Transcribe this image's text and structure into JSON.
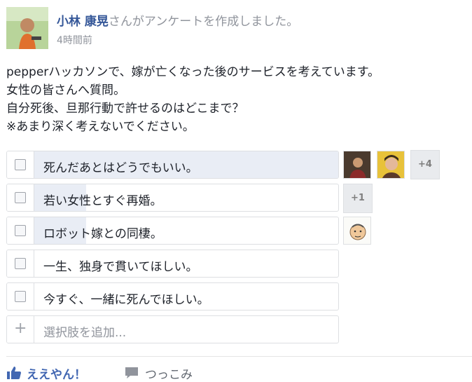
{
  "post": {
    "author": "小林 康晃",
    "action": "さんがアンケートを作成しました。",
    "time": "4時間前",
    "body_lines": [
      "pepperハッカソンで、嫁が亡くなった後のサービスを考えています。",
      "女性の皆さんへ質問。",
      "自分死後、旦那行動で許せるのはどこまで？",
      "※あまり深く考えないでください。"
    ]
  },
  "poll": {
    "options": [
      {
        "label": "死んだあとはどうでもいい。",
        "vote_share": 1.0,
        "more_voters": "+4"
      },
      {
        "label": "若い女性とすぐ再婚。",
        "vote_share": 0.17,
        "more_voters": "+1"
      },
      {
        "label": "ロボット嫁との同棲。",
        "vote_share": 0.17,
        "more_voters": ""
      },
      {
        "label": "一生、独身で貫いてほしい。",
        "vote_share": 0.0,
        "more_voters": ""
      },
      {
        "label": "今すぐ、一緒に死んでほしい。",
        "vote_share": 0.0,
        "more_voters": ""
      }
    ],
    "add_option_placeholder": "選択肢を追加..."
  },
  "footer": {
    "like_label": "ええやん！",
    "comment_label": "つっこみ"
  },
  "colors": {
    "link_blue": "#365899",
    "like_blue": "#4267b2",
    "meta_gray": "#90949c",
    "poll_fill": "#e9edf5",
    "border": "#dddfe2"
  }
}
